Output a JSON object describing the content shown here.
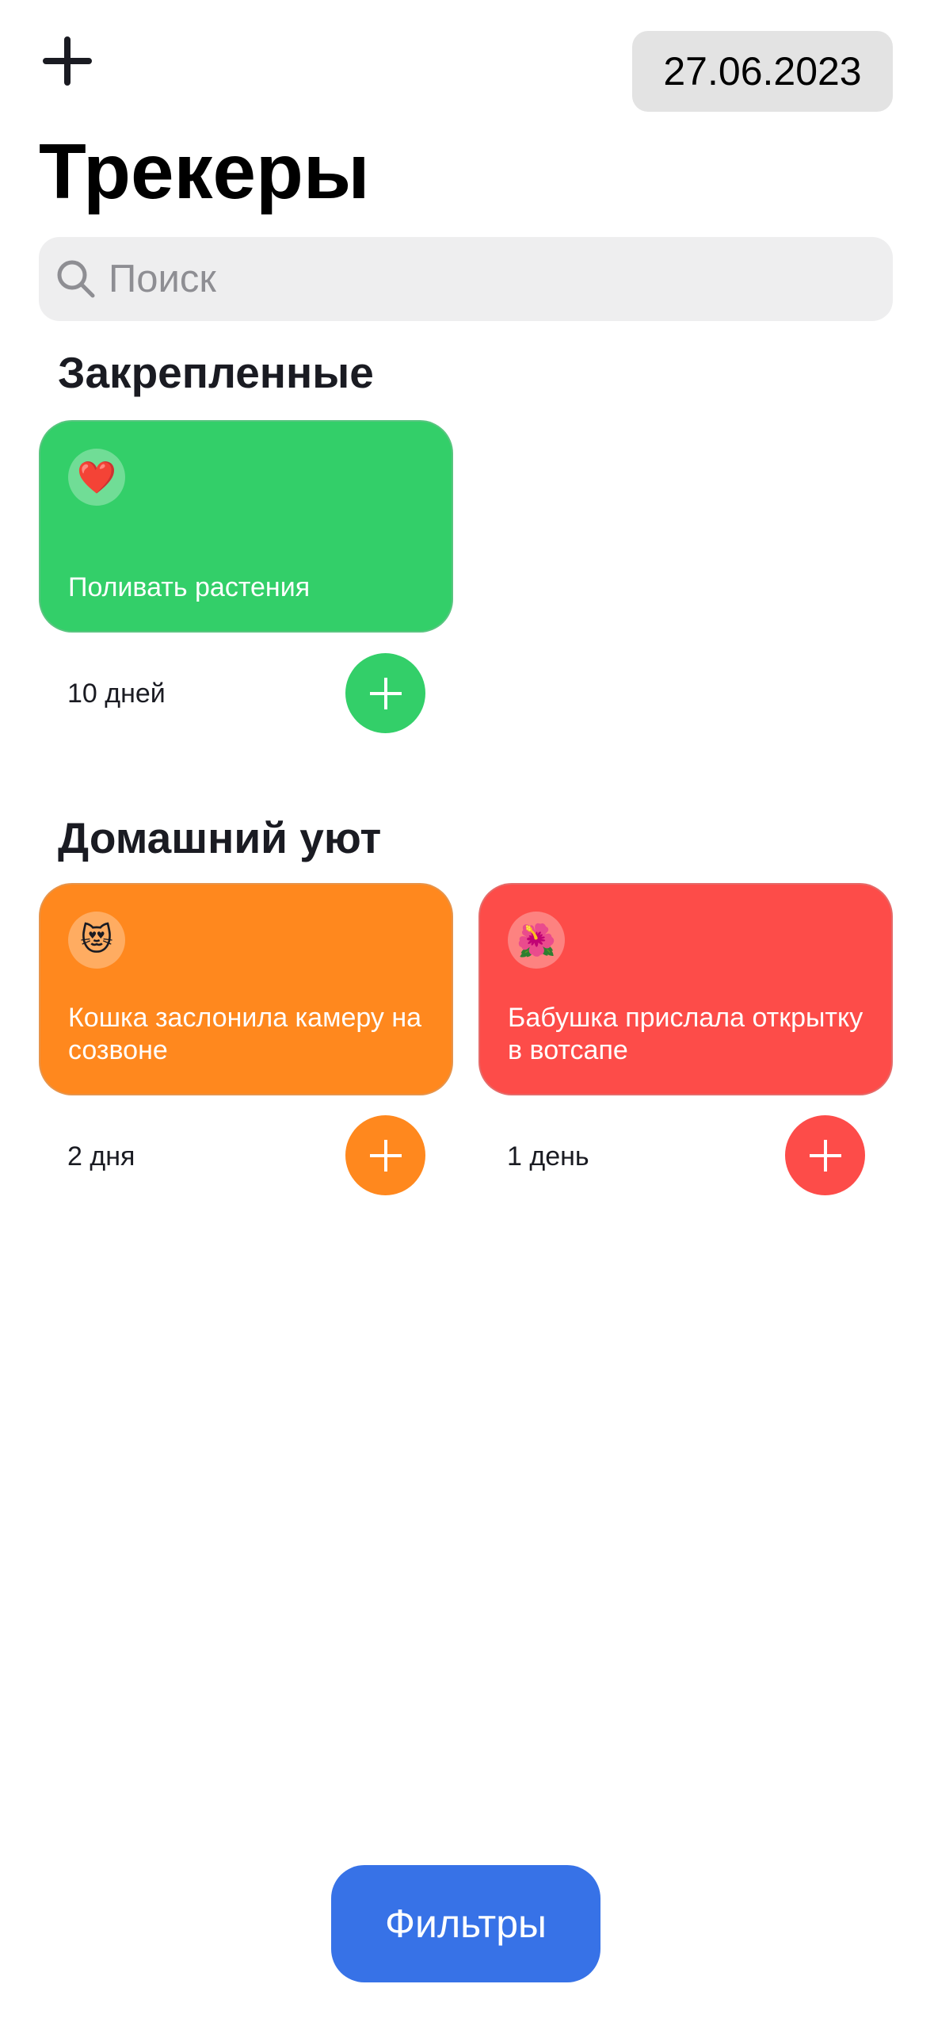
{
  "header": {
    "add_icon": "plus-icon",
    "date": "27.06.2023",
    "title": "Трекеры"
  },
  "search": {
    "placeholder": "Поиск",
    "value": "",
    "icon": "magnifying-glass-icon"
  },
  "sections": [
    {
      "title": "Закрепленные",
      "trackers": [
        {
          "emoji": "❤️",
          "name": "Поливать растения",
          "days": "10 дней",
          "color": "#33CF69"
        }
      ]
    },
    {
      "title": "Домашний уют",
      "trackers": [
        {
          "emoji": "😻",
          "name": "Кошка заслонила камеру на созвоне",
          "days": "2 дня",
          "color": "#FF881E"
        },
        {
          "emoji": "🌺",
          "name": "Бабушка прислала открытку в вотсапе",
          "days": "1 день",
          "color": "#FD4C49"
        }
      ]
    }
  ],
  "filters_label": "Фильтры",
  "colors": {
    "accent": "#3772E7",
    "text": "#1A1B22"
  }
}
